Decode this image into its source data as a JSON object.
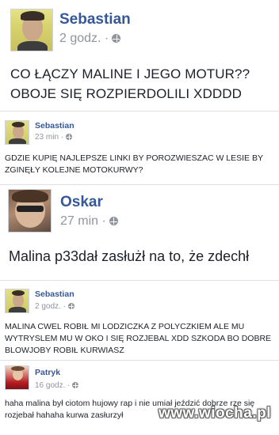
{
  "posts": [
    {
      "author": "Sebastian",
      "time": "2 godz. ·",
      "text": "CO ŁĄCZY MALINE I JEGO MOTUR??\nOBOJE SIĘ ROZPIERDOLILI XDDDD"
    },
    {
      "author": "Sebastian",
      "time": "23 min ·",
      "text": "GDZIE KUPIĘ NAJLEPSZE LINKI BY POROZWIESZAC W LESIE BY\nZGINĘŁY KOLEJNE MOTOKURWY?"
    },
    {
      "author": "Oskar",
      "time": "27 min ·",
      "text": "Malina p33dał zasłużł na to, że zdechł"
    },
    {
      "author": "Sebastian",
      "time": "2 godz. ·",
      "text": "MALINA CWEL ROBIŁ MI LODZICZKA Z POLYCZKIEM ALE MU\nWYTRYSLEM MU W OKO I SIĘ ROZJEBAL XDD SZKODA BO DOBRE\nBLOWJOBY ROBIŁ KURWIASZ"
    },
    {
      "author": "Patryk",
      "time": "16 godz. ·",
      "text": "haha malina był ciotom hujowy rap i nie umiał jeździć dobrze rze się\nrozjebał hahaha kurwa zasłurzył"
    }
  ],
  "watermark": "www.wiocha.pl",
  "colors": {
    "name": "#365899",
    "meta": "#90949c",
    "text": "#1d2129"
  }
}
